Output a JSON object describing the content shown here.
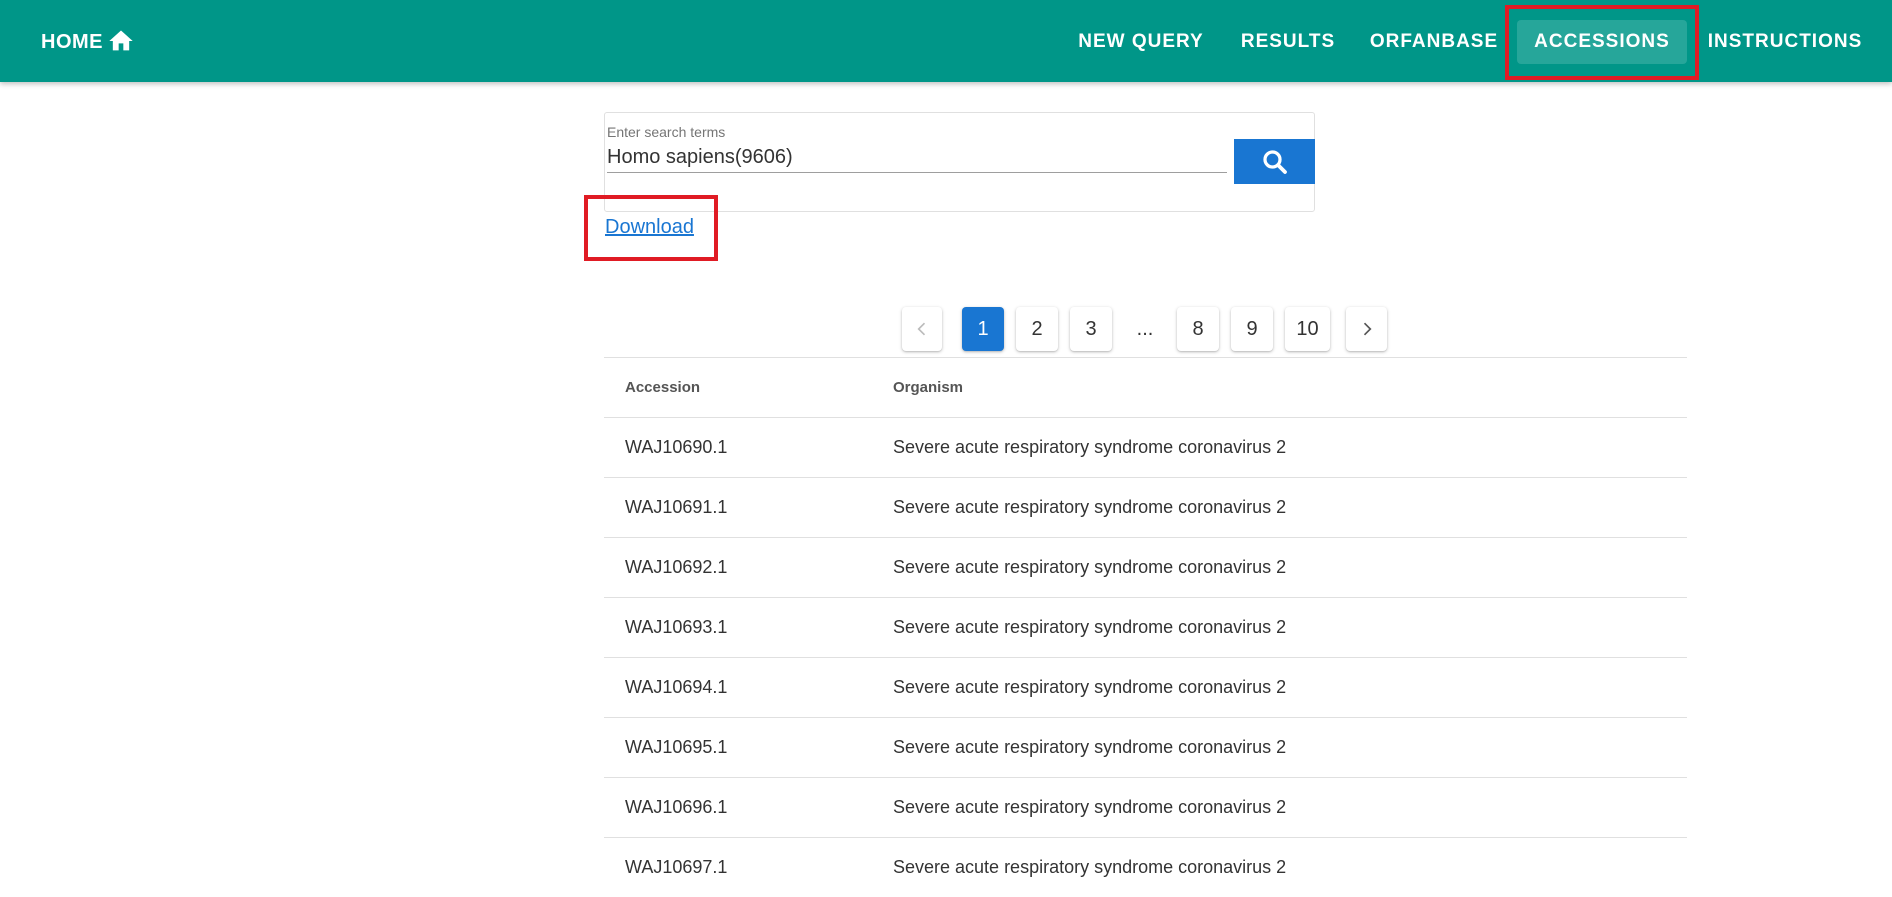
{
  "header": {
    "home_label": "HOME",
    "nav": [
      {
        "label": "NEW QUERY"
      },
      {
        "label": "RESULTS"
      },
      {
        "label": "ORFANBASE"
      },
      {
        "label": "ACCESSIONS",
        "active": true
      },
      {
        "label": "INSTRUCTIONS"
      }
    ]
  },
  "search": {
    "label": "Enter search terms",
    "value": "Homo sapiens(9606)"
  },
  "download_label": "Download",
  "pagination": {
    "pages": [
      "1",
      "2",
      "3",
      "8",
      "9",
      "10"
    ],
    "ellipsis": "...",
    "current": "1"
  },
  "table": {
    "headers": [
      "Accession",
      "Organism"
    ],
    "rows": [
      [
        "WAJ10690.1",
        "Severe acute respiratory syndrome coronavirus 2"
      ],
      [
        "WAJ10691.1",
        "Severe acute respiratory syndrome coronavirus 2"
      ],
      [
        "WAJ10692.1",
        "Severe acute respiratory syndrome coronavirus 2"
      ],
      [
        "WAJ10693.1",
        "Severe acute respiratory syndrome coronavirus 2"
      ],
      [
        "WAJ10694.1",
        "Severe acute respiratory syndrome coronavirus 2"
      ],
      [
        "WAJ10695.1",
        "Severe acute respiratory syndrome coronavirus 2"
      ],
      [
        "WAJ10696.1",
        "Severe acute respiratory syndrome coronavirus 2"
      ],
      [
        "WAJ10697.1",
        "Severe acute respiratory syndrome coronavirus 2"
      ]
    ]
  },
  "colors": {
    "header_bg": "#009688",
    "active_tab_bg": "#26a69a",
    "accent": "#1976d2",
    "highlight_box": "#e01b24"
  },
  "icons": [
    "home-icon",
    "search-icon",
    "chevron-left-icon",
    "chevron-right-icon"
  ]
}
